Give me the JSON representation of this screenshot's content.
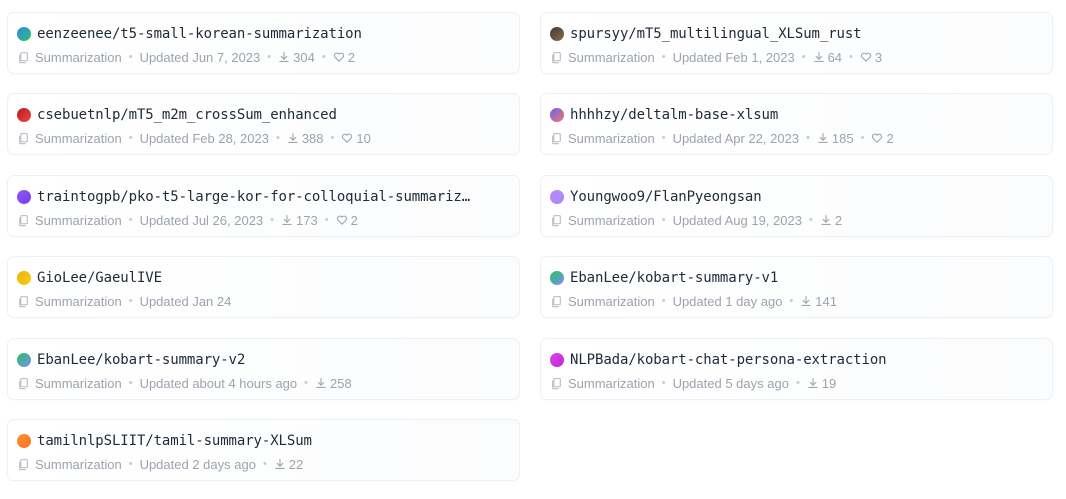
{
  "models": [
    {
      "name": "eenzeenee/t5-small-korean-summarization",
      "task": "Summarization",
      "updated": "Updated Jun 7, 2023",
      "downloads": "304",
      "likes": "2",
      "avatar_color": "#3b82f6",
      "avatar_color2": "#22c55e"
    },
    {
      "name": "spursyy/mT5_multilingual_XLSum_rust",
      "task": "Summarization",
      "updated": "Updated Feb 1, 2023",
      "downloads": "64",
      "likes": "3",
      "avatar_color": "#3f3a36",
      "avatar_color2": "#8b6b4a"
    },
    {
      "name": "csebuetnlp/mT5_m2m_crossSum_enhanced",
      "task": "Summarization",
      "updated": "Updated Feb 28, 2023",
      "downloads": "388",
      "likes": "10",
      "avatar_color": "#b91c1c",
      "avatar_color2": "#ef4444"
    },
    {
      "name": "hhhhzy/deltalm-base-xlsum",
      "task": "Summarization",
      "updated": "Updated Apr 22, 2023",
      "downloads": "185",
      "likes": "2",
      "avatar_color": "#6366f1",
      "avatar_color2": "#f87171"
    },
    {
      "name": "traintogpb/pko-t5-large-kor-for-colloquial-summariz…",
      "task": "Summarization",
      "updated": "Updated Jul 26, 2023",
      "downloads": "173",
      "likes": "2",
      "avatar_color": "#8b5cf6",
      "avatar_color2": "#7c3aed"
    },
    {
      "name": "Youngwoo9/FlanPyeongsan",
      "task": "Summarization",
      "updated": "Updated Aug 19, 2023",
      "downloads": "2",
      "likes": "",
      "avatar_color": "#c084fc",
      "avatar_color2": "#a78bfa"
    },
    {
      "name": "GioLee/GaeulIVE",
      "task": "Summarization",
      "updated": "Updated Jan 24",
      "downloads": "",
      "likes": "",
      "avatar_color": "#eab308",
      "avatar_color2": "#facc15"
    },
    {
      "name": "EbanLee/kobart-summary-v1",
      "task": "Summarization",
      "updated": "Updated 1 day ago",
      "downloads": "141",
      "likes": "",
      "avatar_color": "#22c55e",
      "avatar_color2": "#818cf8"
    },
    {
      "name": "EbanLee/kobart-summary-v2",
      "task": "Summarization",
      "updated": "Updated about 4 hours ago",
      "downloads": "258",
      "likes": "",
      "avatar_color": "#22c55e",
      "avatar_color2": "#818cf8"
    },
    {
      "name": "NLPBada/kobart-chat-persona-extraction",
      "task": "Summarization",
      "updated": "Updated 5 days ago",
      "downloads": "19",
      "likes": "",
      "avatar_color": "#d946ef",
      "avatar_color2": "#c026d3"
    },
    {
      "name": "tamilnlpSLIIT/tamil-summary-XLSum",
      "task": "Summarization",
      "updated": "Updated 2 days ago",
      "downloads": "22",
      "likes": "",
      "avatar_color": "#fb923c",
      "avatar_color2": "#f97316"
    }
  ]
}
